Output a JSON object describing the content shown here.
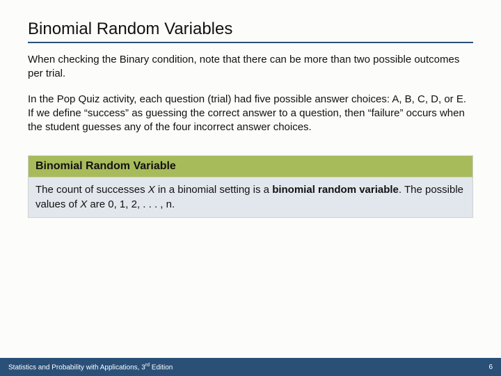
{
  "title": "Binomial Random Variables",
  "paragraphs": {
    "p1": "When checking the Binary condition, note that there can be more than two possible outcomes per trial.",
    "p2": "In the Pop Quiz activity, each question (trial) had five possible answer choices: A, B, C, D, or E. If we define “success” as guessing the correct answer to a question, then “failure” occurs when the student guesses any of the four incorrect answer choices."
  },
  "definition": {
    "header": "Binomial Random Variable",
    "body": {
      "pre": "The count of successes ",
      "var1": "X",
      "mid1": " in a binomial setting is a ",
      "term": "binomial random variable",
      "mid2": ". The possible values of ",
      "var2": "X",
      "post": " are 0, 1, 2, . . . , n."
    }
  },
  "footer": {
    "book_pre": "Statistics and Probability with Applications, 3",
    "book_sup": "rd",
    "book_post": " Edition",
    "page": "6"
  }
}
